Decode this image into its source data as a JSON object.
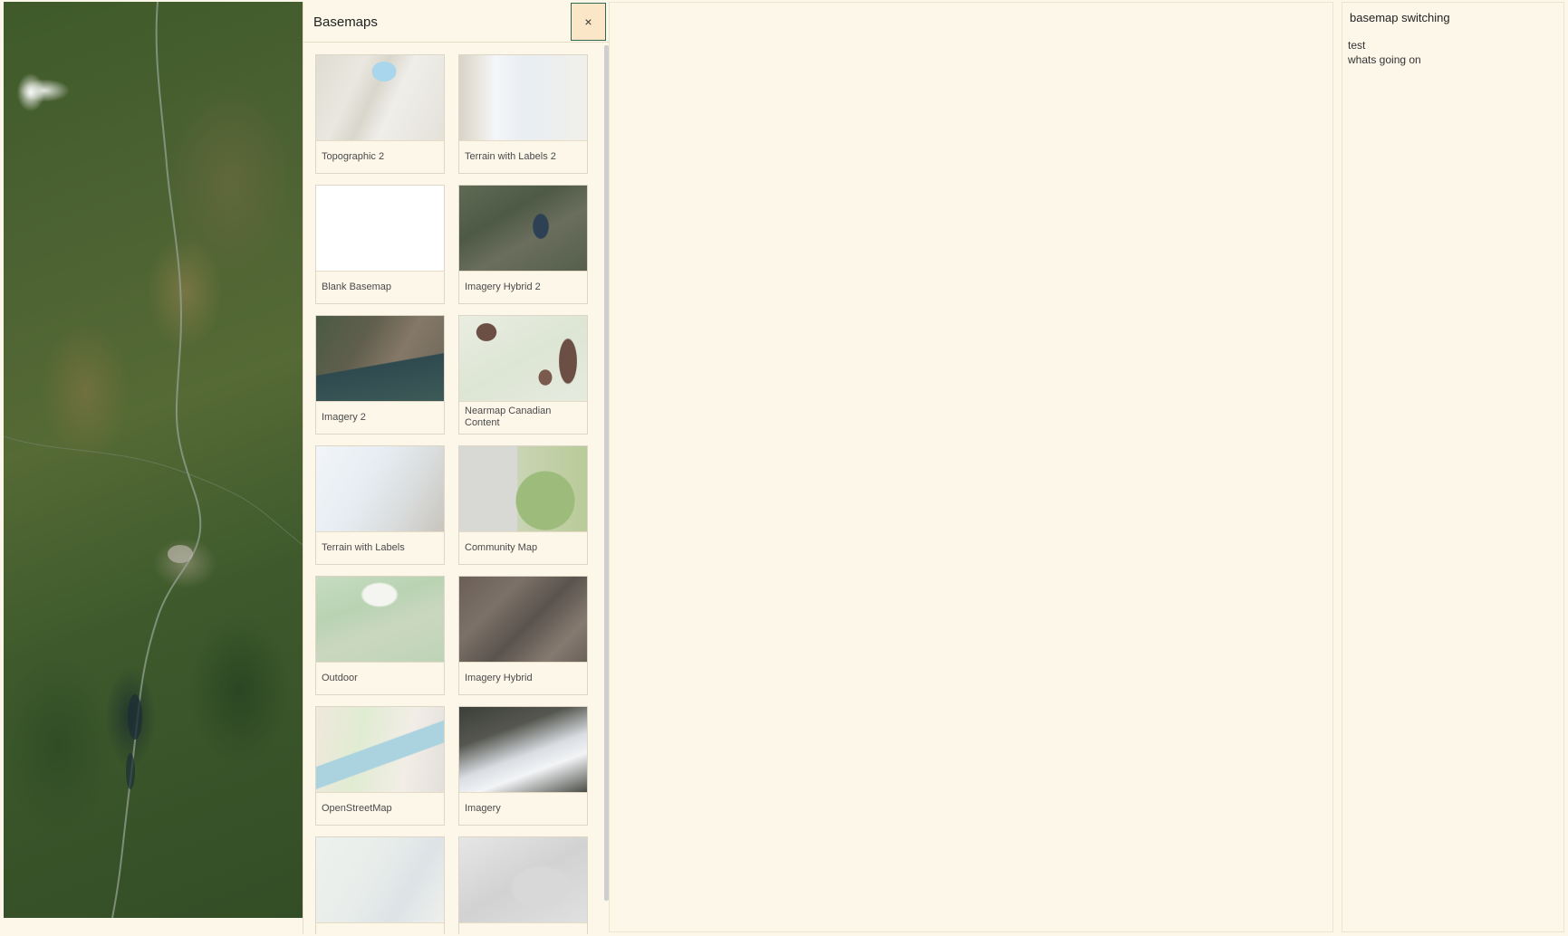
{
  "basemap_panel": {
    "title": "Basemaps",
    "close_icon": "×",
    "items": [
      {
        "label": "Topographic 2",
        "thumb": "topo2"
      },
      {
        "label": "Terrain with Labels 2",
        "thumb": "terrain2"
      },
      {
        "label": "Blank Basemap",
        "thumb": "blank"
      },
      {
        "label": "Imagery Hybrid 2",
        "thumb": "imghybrid2"
      },
      {
        "label": "Imagery 2",
        "thumb": "imagery2"
      },
      {
        "label": "Nearmap Canadian Content",
        "thumb": "nearmap"
      },
      {
        "label": "Terrain with Labels",
        "thumb": "terrainlabels"
      },
      {
        "label": "Community Map",
        "thumb": "community"
      },
      {
        "label": "Outdoor",
        "thumb": "outdoor"
      },
      {
        "label": "Imagery Hybrid",
        "thumb": "imghybrid"
      },
      {
        "label": "OpenStreetMap",
        "thumb": "osm"
      },
      {
        "label": "Imagery",
        "thumb": "imagery"
      },
      {
        "label": "",
        "thumb": "streets"
      },
      {
        "label": "",
        "thumb": "lightgray"
      }
    ]
  },
  "sidebar": {
    "title": "basemap switching",
    "lines": [
      "test",
      "whats going on"
    ]
  },
  "colors": {
    "background": "#fdf7ea",
    "close_button_bg": "#fbe6c8",
    "close_button_border": "#2d6a4f"
  }
}
